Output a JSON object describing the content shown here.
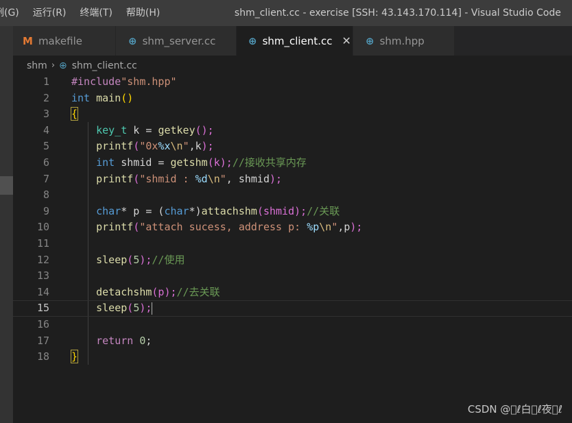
{
  "menu": {
    "items": [
      "例(G)",
      "运行(R)",
      "终端(T)",
      "帮助(H)"
    ]
  },
  "window_title": "shm_client.cc - exercise [SSH: 43.143.170.114] - Visual Studio Code",
  "tabs": [
    {
      "label": "makefile",
      "icon": "M"
    },
    {
      "label": "shm_server.cc",
      "icon": "G"
    },
    {
      "label": "shm_client.cc",
      "icon": "G",
      "close": "✕"
    },
    {
      "label": "shm.hpp",
      "icon": "G"
    }
  ],
  "breadcrumb": {
    "folder": "shm",
    "separator": "›",
    "file": "shm_client.cc"
  },
  "line_numbers": [
    "1",
    "2",
    "3",
    "4",
    "5",
    "6",
    "7",
    "8",
    "9",
    "10",
    "11",
    "12",
    "13",
    "14",
    "15",
    "16",
    "17",
    "18"
  ],
  "code": {
    "l1_directive": "#include",
    "l1_header": "\"shm.hpp\"",
    "l2_type": "int",
    "l2_name": "main",
    "l2_parens": "()",
    "l3_open": "{",
    "l4_type": "key_t",
    "l4_mid": " k = ",
    "l4_fn": "getkey",
    "l4_args": "();",
    "l5_fn": "printf",
    "l5_open": "(",
    "l5_str1": "\"0x",
    "l5_fmt": "%x",
    "l5_esc": "\\n",
    "l5_str2": "\"",
    "l5_rest": ",k",
    "l5_close": ");",
    "l6_type": "int",
    "l6_mid": " shmid = ",
    "l6_fn": "getshm",
    "l6_args": "(k);",
    "l6_comment": "//接收共享内存",
    "l7_fn": "printf",
    "l7_open": "(",
    "l7_str1": "\"shmid : ",
    "l7_fmt": "%d",
    "l7_esc": "\\n",
    "l7_str2": "\"",
    "l7_rest": ", shmid",
    "l7_close": ");",
    "l9_type": "char",
    "l9_mid": "* p = (",
    "l9_cast": "char",
    "l9_mid2": "*)",
    "l9_fn": "attachshm",
    "l9_args": "(shmid);",
    "l9_comment": "//关联",
    "l10_fn": "printf",
    "l10_open": "(",
    "l10_str1": "\"attach sucess, address p: ",
    "l10_fmt": "%p",
    "l10_esc": "\\n",
    "l10_str2": "\"",
    "l10_rest": ",p",
    "l10_close": ");",
    "l12_fn": "sleep",
    "l12_open": "(",
    "l12_num": "5",
    "l12_close": ");",
    "l12_comment": "//使用",
    "l14_fn": "detachshm",
    "l14_args": "(p);",
    "l14_comment": "//去关联",
    "l15_fn": "sleep",
    "l15_open": "(",
    "l15_num": "5",
    "l15_close": ");",
    "l17_kw": "return",
    "l17_num": "0",
    "l17_end": ";",
    "l18_close": "}"
  },
  "watermark": "CSDN @\u0000ℓ白\u0000ℓ夜\u0000ℓ",
  "colors": {
    "keyword": "#569cd6",
    "function": "#dcdcaa",
    "string": "#ce9178",
    "number": "#b5cea8",
    "comment": "#6a9955",
    "preprocessor": "#c586c0"
  }
}
